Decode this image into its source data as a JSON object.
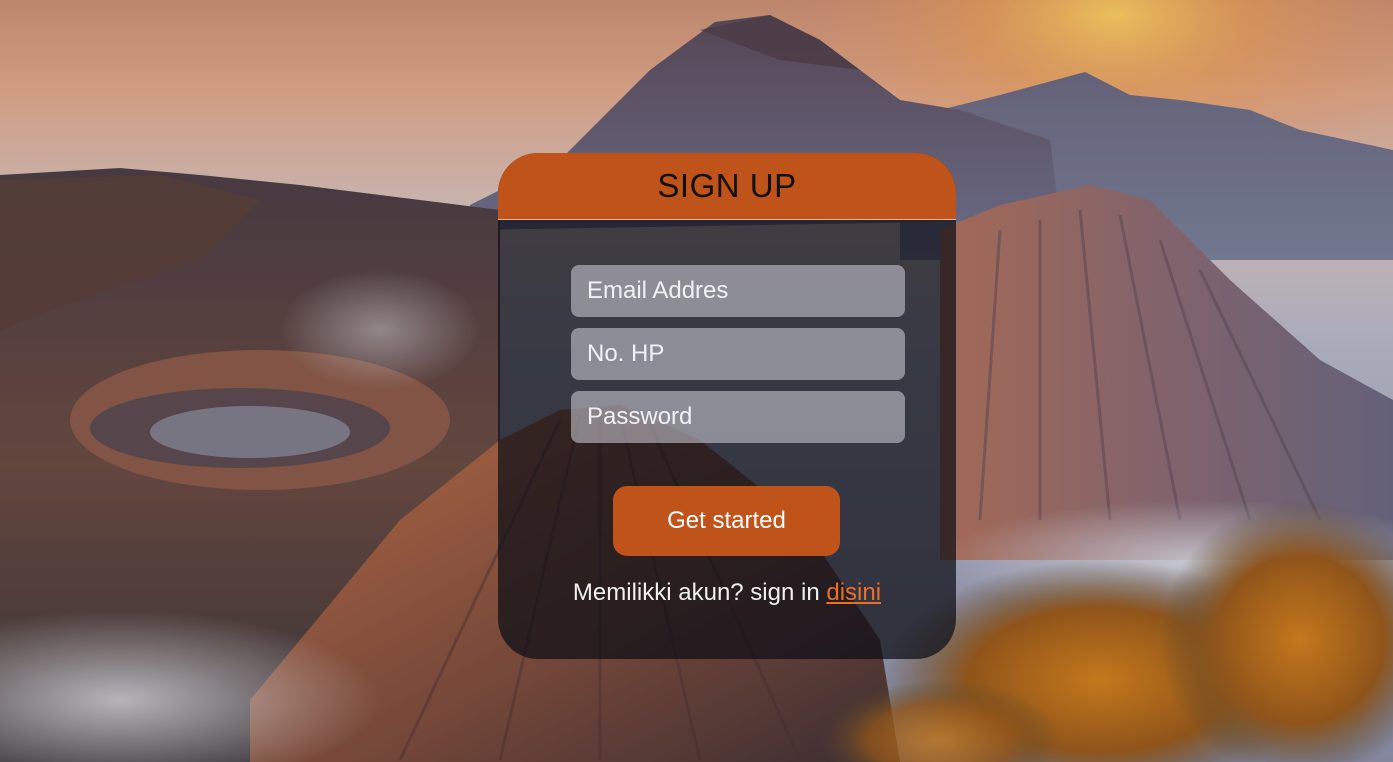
{
  "signup": {
    "title": "SIGN UP",
    "email_placeholder": "Email Addres",
    "phone_placeholder": "No. HP",
    "password_placeholder": "Password",
    "submit_label": "Get started",
    "signin_prompt": "Memilikki akun? sign in",
    "signin_link_label": "disini"
  },
  "colors": {
    "accent": "#c0531a",
    "link": "#e8702a",
    "card_overlay": "rgba(12,14,22,0.72)"
  }
}
